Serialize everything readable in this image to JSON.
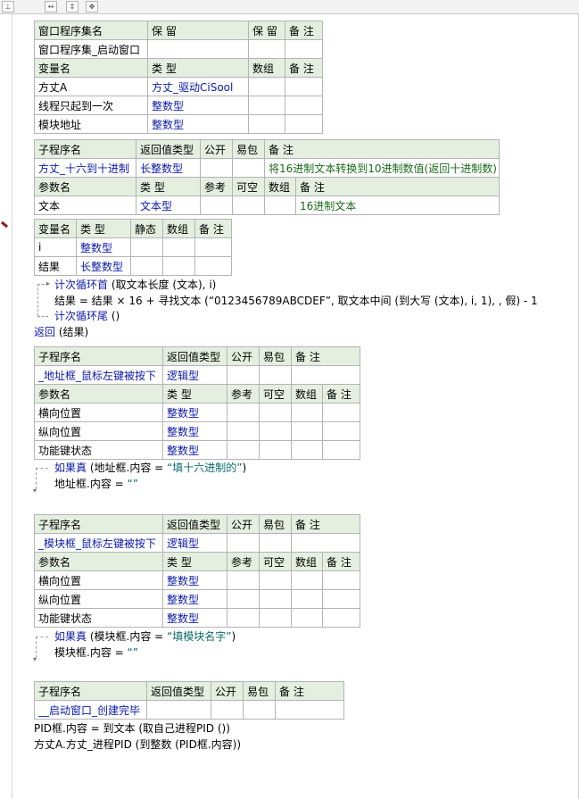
{
  "toolbar": {
    "buttons": [
      "⊥",
      "↔",
      "↕",
      "✥"
    ]
  },
  "window_table": {
    "header": [
      "窗口程序集名",
      "保 留",
      "保 留",
      "备 注"
    ],
    "row": [
      "窗口程序集_启动窗口",
      "",
      "",
      ""
    ],
    "var_header": [
      "变量名",
      "类 型",
      "数组",
      "备 注"
    ],
    "vars": [
      [
        "方丈A",
        "方丈_驱动CiSool",
        "",
        ""
      ],
      [
        "线程只起到一次",
        "整数型",
        "",
        ""
      ],
      [
        "模块地址",
        "整数型",
        "",
        ""
      ]
    ]
  },
  "sub1": {
    "header": [
      "子程序名",
      "返回值类型",
      "公开",
      "易包",
      "备 注"
    ],
    "row": [
      "方丈_十六到十进制",
      "长整数型",
      "",
      "",
      "将16进制文本转换到10进制数值(返回十进制数)"
    ],
    "param_header": [
      "参数名",
      "类 型",
      "参考",
      "可空",
      "数组",
      "备 注"
    ],
    "params": [
      [
        "文本",
        "文本型",
        "",
        "",
        "",
        "16进制文本"
      ]
    ],
    "local_header": [
      "变量名",
      "类 型",
      "静态",
      "数组",
      "备 注"
    ],
    "locals": [
      [
        "i",
        "整数型",
        "",
        "",
        ""
      ],
      [
        "结果",
        "长整数型",
        "",
        "",
        ""
      ]
    ],
    "code": {
      "line1_kw": "计次循环首",
      "line1_rest": " (取文本长度 (文本), i)",
      "line2": "结果 = 结果 × 16 + 寻找文本 (“0123456789ABCDEF”, 取文本中间 (到大写 (文本), i, 1), , 假) - 1",
      "line3_kw": "计次循环尾",
      "line3_rest": " ()",
      "line4_kw": "返回",
      "line4_rest": " (结果)"
    }
  },
  "sub2": {
    "header": [
      "子程序名",
      "返回值类型",
      "公开",
      "易包",
      "备 注"
    ],
    "row": [
      "_地址框_鼠标左键被按下",
      "逻辑型",
      "",
      "",
      ""
    ],
    "param_header": [
      "参数名",
      "类 型",
      "参考",
      "可空",
      "数组",
      "备 注"
    ],
    "params": [
      [
        "横向位置",
        "整数型"
      ],
      [
        "纵向位置",
        "整数型"
      ],
      [
        "功能键状态",
        "整数型"
      ]
    ],
    "code": {
      "if_kw": "如果真",
      "if_rest": " (地址框.内容 = ",
      "if_str": "“填十六进制的”",
      "if_end": ")",
      "body": "地址框.内容 = ",
      "body_str": "“”"
    }
  },
  "sub3": {
    "header": [
      "子程序名",
      "返回值类型",
      "公开",
      "易包",
      "备 注"
    ],
    "row": [
      "_模块框_鼠标左键被按下",
      "逻辑型",
      "",
      "",
      ""
    ],
    "param_header": [
      "参数名",
      "类 型",
      "参考",
      "可空",
      "数组",
      "备 注"
    ],
    "params": [
      [
        "横向位置",
        "整数型"
      ],
      [
        "纵向位置",
        "整数型"
      ],
      [
        "功能键状态",
        "整数型"
      ]
    ],
    "code": {
      "if_kw": "如果真",
      "if_rest": " (模块框.内容 = ",
      "if_str": "“填模块名字”",
      "if_end": ")",
      "body": "模块框.内容 = ",
      "body_str": "“”"
    }
  },
  "sub4": {
    "header": [
      "子程序名",
      "返回值类型",
      "公开",
      "易包",
      "备 注"
    ],
    "row": [
      "__启动窗口_创建完毕",
      "",
      "",
      "",
      ""
    ],
    "code": {
      "line1": "PID框.内容 = 到文本 (取自己进程PID ())",
      "line2": "方丈A.方丈_进程PID (到整数 (PID框.内容))"
    }
  }
}
